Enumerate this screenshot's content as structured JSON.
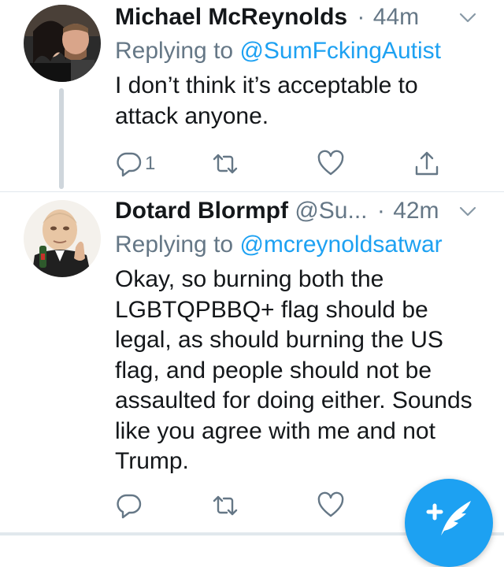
{
  "tweets": [
    {
      "display_name": "Michael McReynolds",
      "handle": "",
      "dot": "·",
      "time": "44m",
      "replying_prefix": "Replying to ",
      "replying_handle": "@SumFckingAutist",
      "text": "I don’t think it’s acceptable to attack anyone.",
      "reply_count": "1",
      "avatar_icon": "couple-photo-avatar"
    },
    {
      "display_name": "Dotard Blormpf",
      "handle": "@Su...",
      "dot": "·",
      "time": "42m",
      "replying_prefix": "Replying to ",
      "replying_handle": "@mcreynoldsatwar",
      "text": "Okay, so burning both the LGBTQPBBQ+ flag should be legal, as should burning the US flag, and people should not be assaulted for doing either. Sounds like you agree with me and not Trump.",
      "reply_count": "",
      "avatar_icon": "masked-man-avatar"
    }
  ],
  "icons": {
    "reply": "reply-icon",
    "retweet": "retweet-icon",
    "like": "heart-icon",
    "share": "share-icon",
    "menu": "chevron-down-icon",
    "compose": "compose-tweet-icon"
  },
  "colors": {
    "accent": "#1da1f2",
    "secondary_text": "#657786",
    "primary_text": "#14171a",
    "thread_line": "#cfd6dc"
  }
}
